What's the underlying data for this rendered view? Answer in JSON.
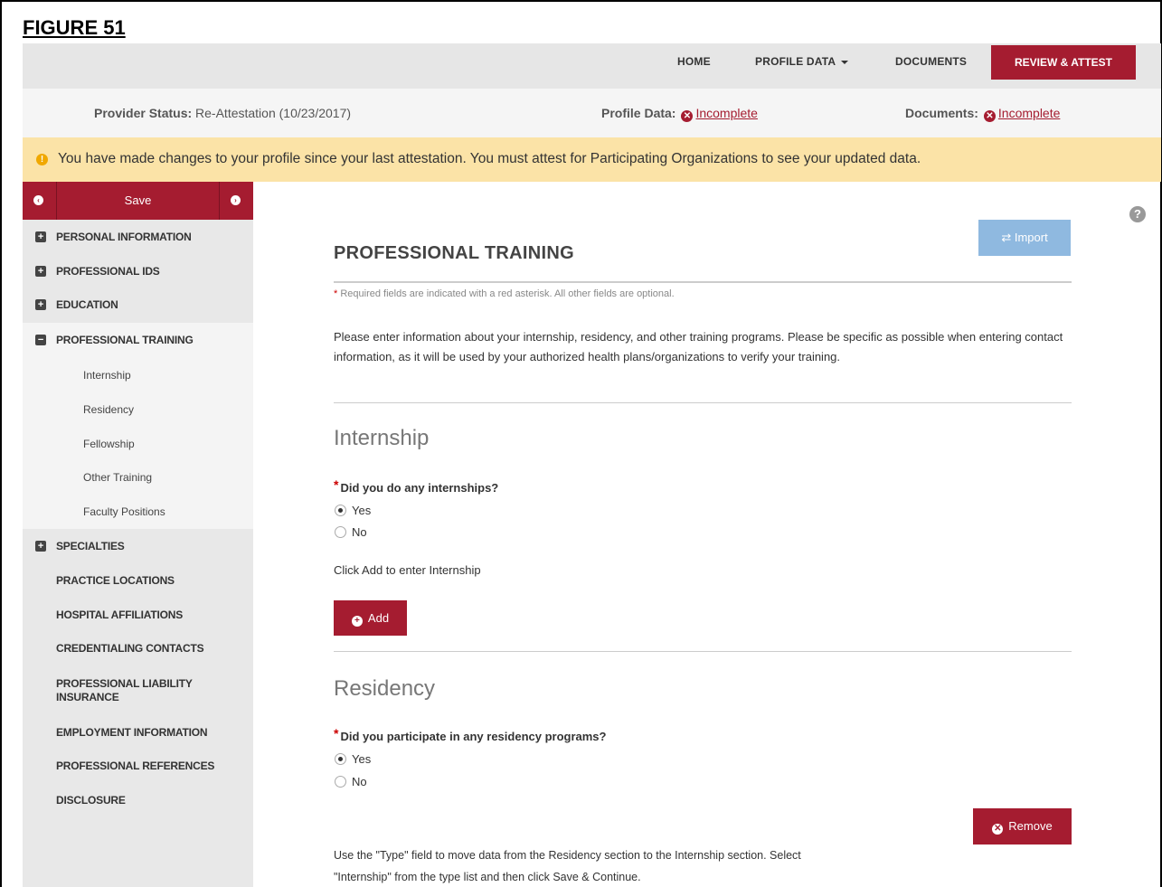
{
  "figure_label": "FIGURE 51",
  "topnav": {
    "home": "HOME",
    "profile_data": "PROFILE DATA",
    "documents": "DOCUMENTS",
    "review_attest": "REVIEW & ATTEST"
  },
  "status": {
    "provider_label": "Provider Status:",
    "provider_value": "Re-Attestation (10/23/2017)",
    "profile_label": "Profile Data:",
    "profile_value": "Incomplete",
    "documents_label": "Documents:",
    "documents_value": "Incomplete"
  },
  "alert": {
    "text": "You have made changes to your profile since your last attestation. You must attest for Participating Organizations to see your updated data."
  },
  "sidebar": {
    "save_label": "Save",
    "items": [
      {
        "label": "PERSONAL INFORMATION",
        "icon": "plus-box-icon"
      },
      {
        "label": "PROFESSIONAL IDS",
        "icon": "plus-box-icon"
      },
      {
        "label": "EDUCATION",
        "icon": "plus-box-icon"
      },
      {
        "label": "PROFESSIONAL TRAINING",
        "icon": "minus-box-icon"
      },
      {
        "label": "SPECIALTIES",
        "icon": "plus-box-icon"
      },
      {
        "label": "PRACTICE LOCATIONS"
      },
      {
        "label": "HOSPITAL AFFILIATIONS"
      },
      {
        "label": "CREDENTIALING CONTACTS"
      },
      {
        "label": "PROFESSIONAL LIABILITY INSURANCE"
      },
      {
        "label": "EMPLOYMENT INFORMATION"
      },
      {
        "label": "PROFESSIONAL REFERENCES"
      },
      {
        "label": "DISCLOSURE"
      }
    ],
    "sub_items": [
      "Internship",
      "Residency",
      "Fellowship",
      "Other Training",
      "Faculty Positions"
    ]
  },
  "main": {
    "import_label": "Import",
    "title": "PROFESSIONAL TRAINING",
    "required_note": "Required fields are indicated with a red asterisk. All other fields are optional.",
    "intro": "Please enter information about your internship, residency, and other training programs. Please be specific as possible when entering contact information, as it will be used by your authorized health plans/organizations to verify your training.",
    "internship": {
      "title": "Internship",
      "question": "Did you do any internships?",
      "yes": "Yes",
      "no": "No",
      "selected": "Yes",
      "click_add": "Click Add to enter Internship",
      "add_label": "Add"
    },
    "residency": {
      "title": "Residency",
      "question": "Did you participate in any residency programs?",
      "yes": "Yes",
      "no": "No",
      "selected": "Yes",
      "remove_label": "Remove",
      "note": "Use the \"Type\" field to move data from the Residency section to the Internship section. Select \"Internship\" from the type list and then click Save & Continue."
    }
  },
  "colors": {
    "accent": "#a51c30",
    "alert_bg": "#fbe3a7",
    "import_btn": "#8fb9e0"
  }
}
